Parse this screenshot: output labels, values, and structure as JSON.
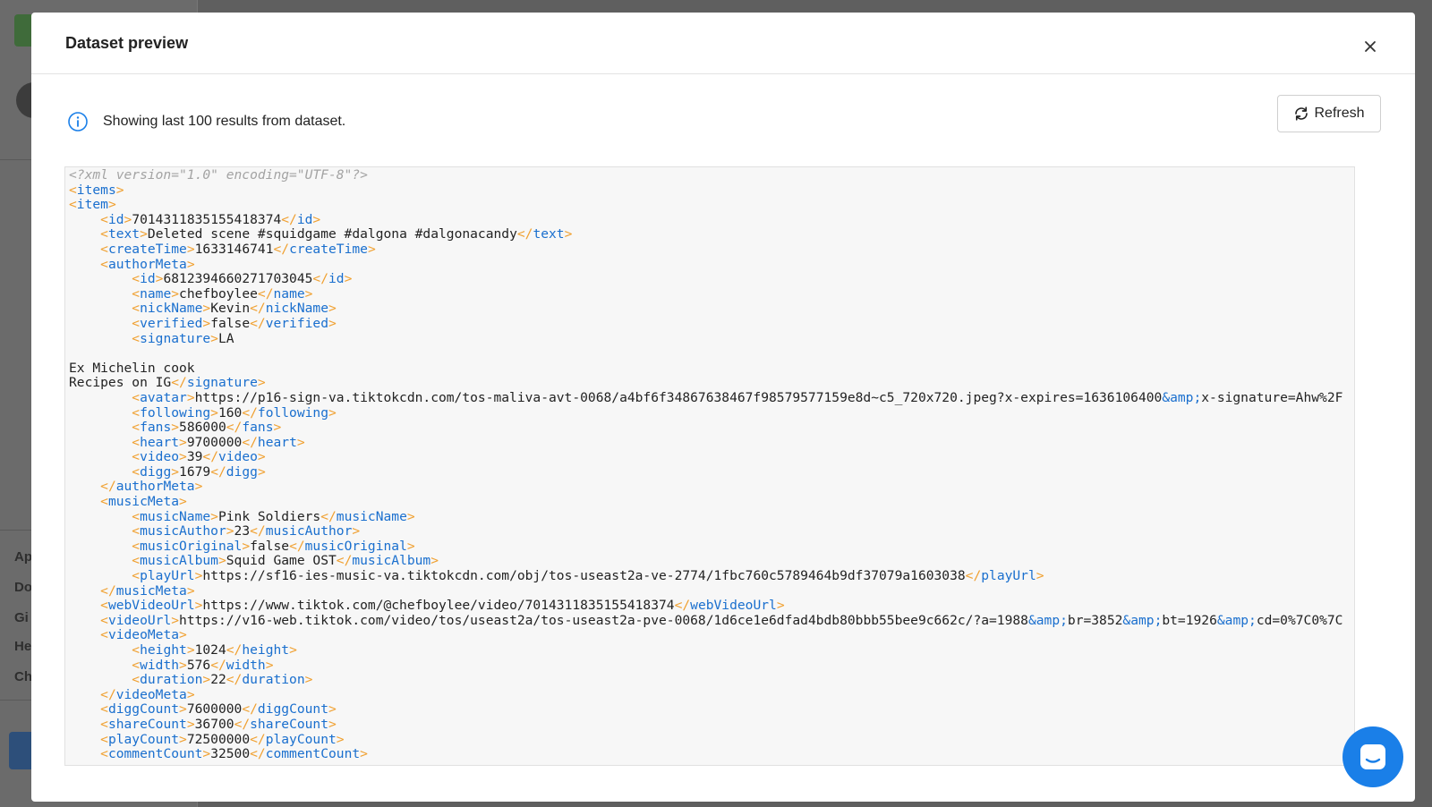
{
  "modal": {
    "title": "Dataset preview",
    "info_text": "Showing last 100 results from dataset.",
    "refresh_label": "Refresh"
  },
  "background_nav": [
    "Ap",
    "Do",
    "Gi",
    "He",
    "Ch"
  ],
  "icons": {
    "close": "close-icon",
    "info": "info-icon",
    "refresh": "refresh-icon",
    "chat": "chat-icon"
  },
  "colors": {
    "tag_bracket": "#f0a030",
    "tag_name": "#1a6fce",
    "comment": "#a3a3a3",
    "chat": "#1a7fe8"
  },
  "code_lines": [
    [
      [
        "c",
        "<?xml version=\"1.0\" encoding=\"UTF-8\"?>"
      ]
    ],
    [
      [
        "b",
        "<"
      ],
      [
        "t",
        "items"
      ],
      [
        "b",
        ">"
      ]
    ],
    [
      [
        "b",
        "<"
      ],
      [
        "t",
        "item"
      ],
      [
        "b",
        ">"
      ]
    ],
    [
      [
        "x",
        "    "
      ],
      [
        "b",
        "<"
      ],
      [
        "t",
        "id"
      ],
      [
        "b",
        ">"
      ],
      [
        "x",
        "7014311835155418374"
      ],
      [
        "b",
        "</"
      ],
      [
        "t",
        "id"
      ],
      [
        "b",
        ">"
      ]
    ],
    [
      [
        "x",
        "    "
      ],
      [
        "b",
        "<"
      ],
      [
        "t",
        "text"
      ],
      [
        "b",
        ">"
      ],
      [
        "x",
        "Deleted scene #squidgame #dalgona #dalgonacandy"
      ],
      [
        "b",
        "</"
      ],
      [
        "t",
        "text"
      ],
      [
        "b",
        ">"
      ]
    ],
    [
      [
        "x",
        "    "
      ],
      [
        "b",
        "<"
      ],
      [
        "t",
        "createTime"
      ],
      [
        "b",
        ">"
      ],
      [
        "x",
        "1633146741"
      ],
      [
        "b",
        "</"
      ],
      [
        "t",
        "createTime"
      ],
      [
        "b",
        ">"
      ]
    ],
    [
      [
        "x",
        "    "
      ],
      [
        "b",
        "<"
      ],
      [
        "t",
        "authorMeta"
      ],
      [
        "b",
        ">"
      ]
    ],
    [
      [
        "x",
        "        "
      ],
      [
        "b",
        "<"
      ],
      [
        "t",
        "id"
      ],
      [
        "b",
        ">"
      ],
      [
        "x",
        "6812394660271703045"
      ],
      [
        "b",
        "</"
      ],
      [
        "t",
        "id"
      ],
      [
        "b",
        ">"
      ]
    ],
    [
      [
        "x",
        "        "
      ],
      [
        "b",
        "<"
      ],
      [
        "t",
        "name"
      ],
      [
        "b",
        ">"
      ],
      [
        "x",
        "chefboylee"
      ],
      [
        "b",
        "</"
      ],
      [
        "t",
        "name"
      ],
      [
        "b",
        ">"
      ]
    ],
    [
      [
        "x",
        "        "
      ],
      [
        "b",
        "<"
      ],
      [
        "t",
        "nickName"
      ],
      [
        "b",
        ">"
      ],
      [
        "x",
        "Kevin"
      ],
      [
        "b",
        "</"
      ],
      [
        "t",
        "nickName"
      ],
      [
        "b",
        ">"
      ]
    ],
    [
      [
        "x",
        "        "
      ],
      [
        "b",
        "<"
      ],
      [
        "t",
        "verified"
      ],
      [
        "b",
        ">"
      ],
      [
        "x",
        "false"
      ],
      [
        "b",
        "</"
      ],
      [
        "t",
        "verified"
      ],
      [
        "b",
        ">"
      ]
    ],
    [
      [
        "x",
        "        "
      ],
      [
        "b",
        "<"
      ],
      [
        "t",
        "signature"
      ],
      [
        "b",
        ">"
      ],
      [
        "x",
        "LA"
      ]
    ],
    [
      [
        "x",
        ""
      ]
    ],
    [
      [
        "x",
        "Ex Michelin cook"
      ]
    ],
    [
      [
        "x",
        "Recipes on IG"
      ],
      [
        "b",
        "</"
      ],
      [
        "t",
        "signature"
      ],
      [
        "b",
        ">"
      ]
    ],
    [
      [
        "x",
        "        "
      ],
      [
        "b",
        "<"
      ],
      [
        "t",
        "avatar"
      ],
      [
        "b",
        ">"
      ],
      [
        "x",
        "https://p16-sign-va.tiktokcdn.com/tos-maliva-avt-0068/a4bf6f34867638467f98579577159e8d~c5_720x720.jpeg?x-expires=1636106400"
      ],
      [
        "e",
        "&amp;"
      ],
      [
        "x",
        "x-signature=Ahw%2F"
      ]
    ],
    [
      [
        "x",
        "        "
      ],
      [
        "b",
        "<"
      ],
      [
        "t",
        "following"
      ],
      [
        "b",
        ">"
      ],
      [
        "x",
        "160"
      ],
      [
        "b",
        "</"
      ],
      [
        "t",
        "following"
      ],
      [
        "b",
        ">"
      ]
    ],
    [
      [
        "x",
        "        "
      ],
      [
        "b",
        "<"
      ],
      [
        "t",
        "fans"
      ],
      [
        "b",
        ">"
      ],
      [
        "x",
        "586000"
      ],
      [
        "b",
        "</"
      ],
      [
        "t",
        "fans"
      ],
      [
        "b",
        ">"
      ]
    ],
    [
      [
        "x",
        "        "
      ],
      [
        "b",
        "<"
      ],
      [
        "t",
        "heart"
      ],
      [
        "b",
        ">"
      ],
      [
        "x",
        "9700000"
      ],
      [
        "b",
        "</"
      ],
      [
        "t",
        "heart"
      ],
      [
        "b",
        ">"
      ]
    ],
    [
      [
        "x",
        "        "
      ],
      [
        "b",
        "<"
      ],
      [
        "t",
        "video"
      ],
      [
        "b",
        ">"
      ],
      [
        "x",
        "39"
      ],
      [
        "b",
        "</"
      ],
      [
        "t",
        "video"
      ],
      [
        "b",
        ">"
      ]
    ],
    [
      [
        "x",
        "        "
      ],
      [
        "b",
        "<"
      ],
      [
        "t",
        "digg"
      ],
      [
        "b",
        ">"
      ],
      [
        "x",
        "1679"
      ],
      [
        "b",
        "</"
      ],
      [
        "t",
        "digg"
      ],
      [
        "b",
        ">"
      ]
    ],
    [
      [
        "x",
        "    "
      ],
      [
        "b",
        "</"
      ],
      [
        "t",
        "authorMeta"
      ],
      [
        "b",
        ">"
      ]
    ],
    [
      [
        "x",
        "    "
      ],
      [
        "b",
        "<"
      ],
      [
        "t",
        "musicMeta"
      ],
      [
        "b",
        ">"
      ]
    ],
    [
      [
        "x",
        "        "
      ],
      [
        "b",
        "<"
      ],
      [
        "t",
        "musicName"
      ],
      [
        "b",
        ">"
      ],
      [
        "x",
        "Pink Soldiers"
      ],
      [
        "b",
        "</"
      ],
      [
        "t",
        "musicName"
      ],
      [
        "b",
        ">"
      ]
    ],
    [
      [
        "x",
        "        "
      ],
      [
        "b",
        "<"
      ],
      [
        "t",
        "musicAuthor"
      ],
      [
        "b",
        ">"
      ],
      [
        "x",
        "23"
      ],
      [
        "b",
        "</"
      ],
      [
        "t",
        "musicAuthor"
      ],
      [
        "b",
        ">"
      ]
    ],
    [
      [
        "x",
        "        "
      ],
      [
        "b",
        "<"
      ],
      [
        "t",
        "musicOriginal"
      ],
      [
        "b",
        ">"
      ],
      [
        "x",
        "false"
      ],
      [
        "b",
        "</"
      ],
      [
        "t",
        "musicOriginal"
      ],
      [
        "b",
        ">"
      ]
    ],
    [
      [
        "x",
        "        "
      ],
      [
        "b",
        "<"
      ],
      [
        "t",
        "musicAlbum"
      ],
      [
        "b",
        ">"
      ],
      [
        "x",
        "Squid Game OST"
      ],
      [
        "b",
        "</"
      ],
      [
        "t",
        "musicAlbum"
      ],
      [
        "b",
        ">"
      ]
    ],
    [
      [
        "x",
        "        "
      ],
      [
        "b",
        "<"
      ],
      [
        "t",
        "playUrl"
      ],
      [
        "b",
        ">"
      ],
      [
        "x",
        "https://sf16-ies-music-va.tiktokcdn.com/obj/tos-useast2a-ve-2774/1fbc760c5789464b9df37079a1603038"
      ],
      [
        "b",
        "</"
      ],
      [
        "t",
        "playUrl"
      ],
      [
        "b",
        ">"
      ]
    ],
    [
      [
        "x",
        "    "
      ],
      [
        "b",
        "</"
      ],
      [
        "t",
        "musicMeta"
      ],
      [
        "b",
        ">"
      ]
    ],
    [
      [
        "x",
        "    "
      ],
      [
        "b",
        "<"
      ],
      [
        "t",
        "webVideoUrl"
      ],
      [
        "b",
        ">"
      ],
      [
        "x",
        "https://www.tiktok.com/@chefboylee/video/7014311835155418374"
      ],
      [
        "b",
        "</"
      ],
      [
        "t",
        "webVideoUrl"
      ],
      [
        "b",
        ">"
      ]
    ],
    [
      [
        "x",
        "    "
      ],
      [
        "b",
        "<"
      ],
      [
        "t",
        "videoUrl"
      ],
      [
        "b",
        ">"
      ],
      [
        "x",
        "https://v16-web.tiktok.com/video/tos/useast2a/tos-useast2a-pve-0068/1d6ce1e6dfad4bdb80bbb55bee9c662c/?a=1988"
      ],
      [
        "e",
        "&amp;"
      ],
      [
        "x",
        "br=3852"
      ],
      [
        "e",
        "&amp;"
      ],
      [
        "x",
        "bt=1926"
      ],
      [
        "e",
        "&amp;"
      ],
      [
        "x",
        "cd=0%7C0%7C"
      ]
    ],
    [
      [
        "x",
        "    "
      ],
      [
        "b",
        "<"
      ],
      [
        "t",
        "videoMeta"
      ],
      [
        "b",
        ">"
      ]
    ],
    [
      [
        "x",
        "        "
      ],
      [
        "b",
        "<"
      ],
      [
        "t",
        "height"
      ],
      [
        "b",
        ">"
      ],
      [
        "x",
        "1024"
      ],
      [
        "b",
        "</"
      ],
      [
        "t",
        "height"
      ],
      [
        "b",
        ">"
      ]
    ],
    [
      [
        "x",
        "        "
      ],
      [
        "b",
        "<"
      ],
      [
        "t",
        "width"
      ],
      [
        "b",
        ">"
      ],
      [
        "x",
        "576"
      ],
      [
        "b",
        "</"
      ],
      [
        "t",
        "width"
      ],
      [
        "b",
        ">"
      ]
    ],
    [
      [
        "x",
        "        "
      ],
      [
        "b",
        "<"
      ],
      [
        "t",
        "duration"
      ],
      [
        "b",
        ">"
      ],
      [
        "x",
        "22"
      ],
      [
        "b",
        "</"
      ],
      [
        "t",
        "duration"
      ],
      [
        "b",
        ">"
      ]
    ],
    [
      [
        "x",
        "    "
      ],
      [
        "b",
        "</"
      ],
      [
        "t",
        "videoMeta"
      ],
      [
        "b",
        ">"
      ]
    ],
    [
      [
        "x",
        "    "
      ],
      [
        "b",
        "<"
      ],
      [
        "t",
        "diggCount"
      ],
      [
        "b",
        ">"
      ],
      [
        "x",
        "7600000"
      ],
      [
        "b",
        "</"
      ],
      [
        "t",
        "diggCount"
      ],
      [
        "b",
        ">"
      ]
    ],
    [
      [
        "x",
        "    "
      ],
      [
        "b",
        "<"
      ],
      [
        "t",
        "shareCount"
      ],
      [
        "b",
        ">"
      ],
      [
        "x",
        "36700"
      ],
      [
        "b",
        "</"
      ],
      [
        "t",
        "shareCount"
      ],
      [
        "b",
        ">"
      ]
    ],
    [
      [
        "x",
        "    "
      ],
      [
        "b",
        "<"
      ],
      [
        "t",
        "playCount"
      ],
      [
        "b",
        ">"
      ],
      [
        "x",
        "72500000"
      ],
      [
        "b",
        "</"
      ],
      [
        "t",
        "playCount"
      ],
      [
        "b",
        ">"
      ]
    ],
    [
      [
        "x",
        "    "
      ],
      [
        "b",
        "<"
      ],
      [
        "t",
        "commentCount"
      ],
      [
        "b",
        ">"
      ],
      [
        "x",
        "32500"
      ],
      [
        "b",
        "</"
      ],
      [
        "t",
        "commentCount"
      ],
      [
        "b",
        ">"
      ]
    ]
  ]
}
